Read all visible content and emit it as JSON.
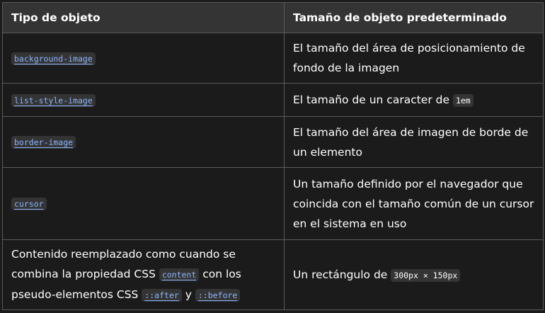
{
  "table": {
    "headers": [
      "Tipo de objeto",
      "Tamaño de objeto predeterminado"
    ],
    "rows": [
      {
        "object_type": "background-image",
        "default_size": "El tamaño del área de posicionamiento de fondo de la imagen"
      },
      {
        "object_type": "list-style-image",
        "default_size_prefix": "El tamaño de un caracter de",
        "default_size_code": "1em"
      },
      {
        "object_type": "border-image",
        "default_size": "El tamaño del área de imagen de borde de un elemento"
      },
      {
        "object_type": "cursor",
        "default_size": "Un tamaño definido por el navegador que coincida con el tamaño común de un cursor en el sistema en uso"
      },
      {
        "object_type_text_1": "Contenido reemplazado como cuando se combina la propiedad CSS",
        "object_type_link_1": "content",
        "object_type_text_2": "con los pseudo-elementos CSS",
        "object_type_link_2": "::after",
        "object_type_text_3": "y",
        "object_type_link_3": "::before",
        "default_size_prefix": "Un rectángulo de",
        "default_size_code": "300px × 150px"
      }
    ]
  },
  "colors": {
    "background": "#1b1b1b",
    "header_background": "#343434",
    "border": "#5b5b5b",
    "link": "#8cb4ff",
    "code_background": "#343434",
    "text": "#ffffff"
  }
}
